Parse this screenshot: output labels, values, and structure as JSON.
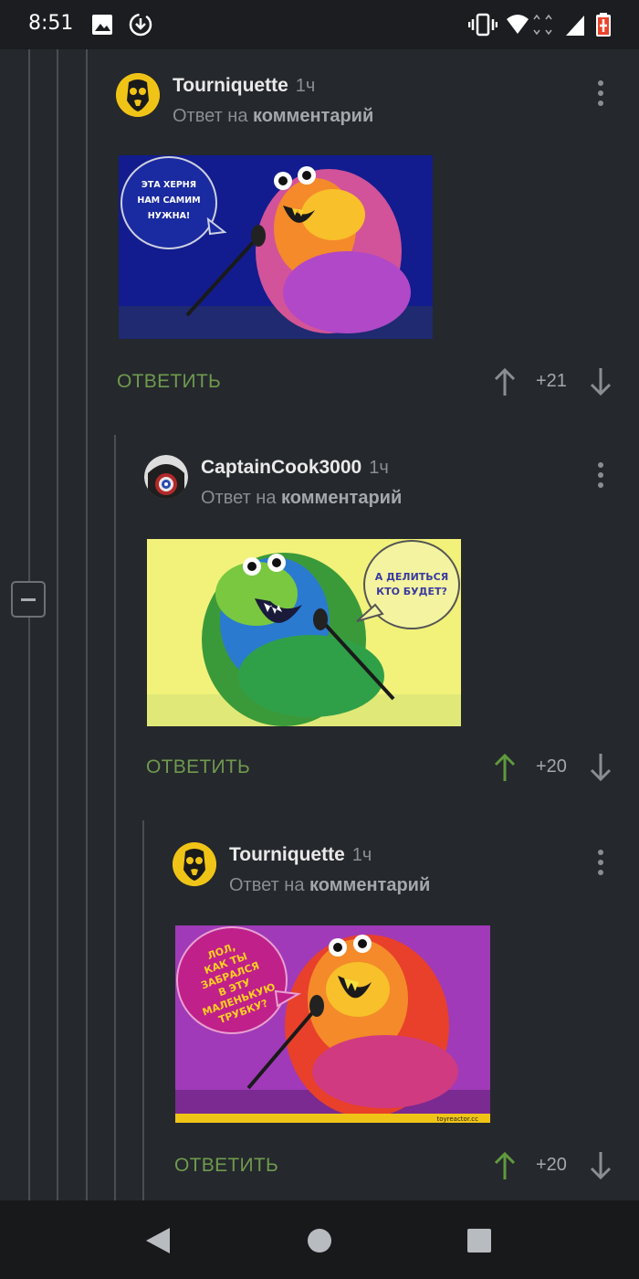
{
  "status_bar": {
    "time": "8:51",
    "icons": [
      "image-icon",
      "download-icon",
      "vibrate-icon",
      "wifi-icon",
      "signal-icon",
      "battery-charging-icon"
    ]
  },
  "comments": [
    {
      "author": "Tourniquette",
      "time": "1ч",
      "reply_prefix": "Ответ на",
      "reply_target": "комментарий",
      "image_text": "ЭТА ХЕРНЯ НАМ САМИМ НУЖНА!",
      "reply_label": "ОТВЕТИТЬ",
      "votes": "+21",
      "upvoted": false
    },
    {
      "author": "CaptainCook3000",
      "time": "1ч",
      "reply_prefix": "Ответ на",
      "reply_target": "комментарий",
      "image_text": "А ДЕЛИТЬСЯ КТО БУДЕТ?",
      "reply_label": "ОТВЕТИТЬ",
      "votes": "+20",
      "upvoted": true
    },
    {
      "author": "Tourniquette",
      "time": "1ч",
      "reply_prefix": "Ответ на",
      "reply_target": "комментарий",
      "image_text": "ЛОЛ, КАК ТЫ ЗАБРАЛСЯ В ЭТУ МАЛЕНЬКУЮ ТРУБКУ?",
      "watermark": "toyreactor.cc",
      "reply_label": "ОТВЕТИТЬ",
      "votes": "+20",
      "upvoted": true
    }
  ],
  "colors": {
    "background": "#25282c",
    "reply_green": "#6f9a4e",
    "upvote_active": "#5f9a3e",
    "vote_inactive": "#8a8e93"
  },
  "nav_bar": {
    "icons": [
      "back-icon",
      "home-icon",
      "recents-icon"
    ]
  }
}
